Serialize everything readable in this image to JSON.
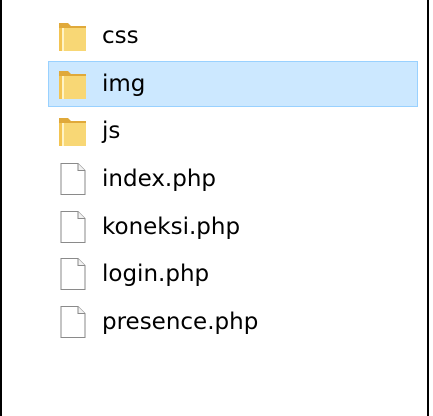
{
  "items": [
    {
      "name": "css",
      "type": "folder",
      "selected": false
    },
    {
      "name": "img",
      "type": "folder",
      "selected": true
    },
    {
      "name": "js",
      "type": "folder",
      "selected": false
    },
    {
      "name": "index.php",
      "type": "file",
      "selected": false
    },
    {
      "name": "koneksi.php",
      "type": "file",
      "selected": false
    },
    {
      "name": "login.php",
      "type": "file",
      "selected": false
    },
    {
      "name": "presence.php",
      "type": "file",
      "selected": false
    }
  ],
  "colors": {
    "selection_fill": "#cce8ff",
    "selection_border": "#99d1ff",
    "folder_yellow": "#f8d775",
    "folder_dark": "#e0a93a"
  }
}
